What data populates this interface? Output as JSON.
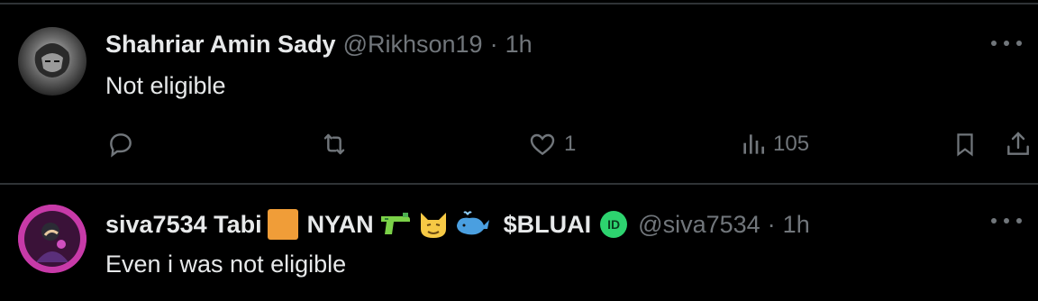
{
  "tweets": [
    {
      "name": "Shahriar Amin Sady",
      "handle": "@Rikhson19",
      "dot": "·",
      "time": "1h",
      "text": "Not eligible",
      "likes": "1",
      "views": "105"
    },
    {
      "name_parts": [
        "siva7534 Tabi",
        "NYAN",
        "$BLUAI"
      ],
      "badge_text": "ID",
      "handle": "@siva7534",
      "dot": "·",
      "time": "1h",
      "text": "Even i was not eligible"
    }
  ],
  "icons": {
    "reply": "reply-icon",
    "retweet": "retweet-icon",
    "like": "heart-icon",
    "views": "views-icon",
    "bookmark": "bookmark-icon",
    "share": "share-icon",
    "more": "more-icon"
  },
  "colors": {
    "background": "#000000",
    "text": "#e7e9ea",
    "muted": "#71767b",
    "divider": "#2f3336",
    "orange_square": "#f09d38",
    "id_badge": "#2dd36f"
  }
}
